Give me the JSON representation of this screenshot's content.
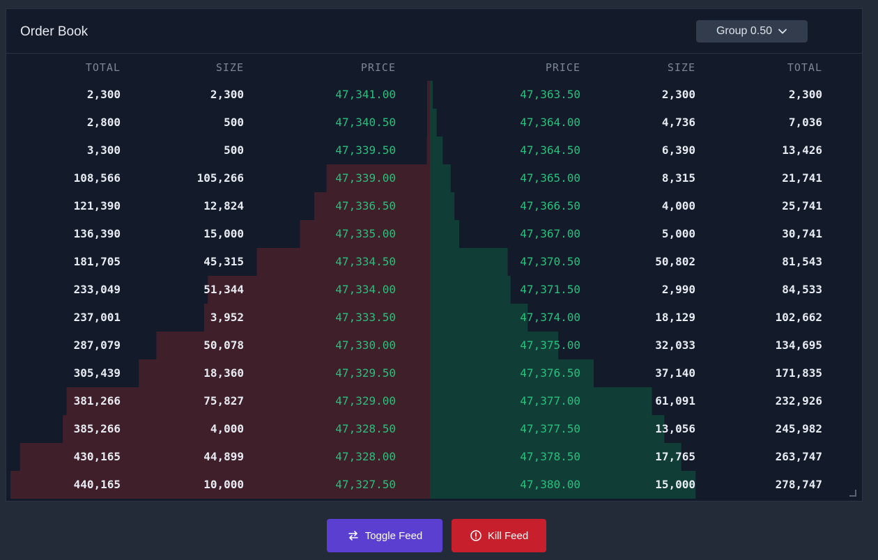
{
  "header": {
    "title": "Order Book",
    "group_label": "Group 0.50"
  },
  "bids": {
    "columns": [
      "TOTAL",
      "SIZE",
      "PRICE"
    ],
    "rows": [
      {
        "total": "2,300",
        "size": "2,300",
        "price": "47,341.00"
      },
      {
        "total": "2,800",
        "size": "500",
        "price": "47,340.50"
      },
      {
        "total": "3,300",
        "size": "500",
        "price": "47,339.50"
      },
      {
        "total": "108,566",
        "size": "105,266",
        "price": "47,339.00"
      },
      {
        "total": "121,390",
        "size": "12,824",
        "price": "47,336.50"
      },
      {
        "total": "136,390",
        "size": "15,000",
        "price": "47,335.00"
      },
      {
        "total": "181,705",
        "size": "45,315",
        "price": "47,334.50"
      },
      {
        "total": "233,049",
        "size": "51,344",
        "price": "47,334.00"
      },
      {
        "total": "237,001",
        "size": "3,952",
        "price": "47,333.50"
      },
      {
        "total": "287,079",
        "size": "50,078",
        "price": "47,330.00"
      },
      {
        "total": "305,439",
        "size": "18,360",
        "price": "47,329.50"
      },
      {
        "total": "381,266",
        "size": "75,827",
        "price": "47,329.00"
      },
      {
        "total": "385,266",
        "size": "4,000",
        "price": "47,328.50"
      },
      {
        "total": "430,165",
        "size": "44,899",
        "price": "47,328.00"
      },
      {
        "total": "440,165",
        "size": "10,000",
        "price": "47,327.50"
      }
    ]
  },
  "asks": {
    "columns": [
      "PRICE",
      "SIZE",
      "TOTAL"
    ],
    "rows": [
      {
        "price": "47,363.50",
        "size": "2,300",
        "total": "2,300"
      },
      {
        "price": "47,364.00",
        "size": "4,736",
        "total": "7,036"
      },
      {
        "price": "47,364.50",
        "size": "6,390",
        "total": "13,426"
      },
      {
        "price": "47,365.00",
        "size": "8,315",
        "total": "21,741"
      },
      {
        "price": "47,366.50",
        "size": "4,000",
        "total": "25,741"
      },
      {
        "price": "47,367.00",
        "size": "5,000",
        "total": "30,741"
      },
      {
        "price": "47,370.50",
        "size": "50,802",
        "total": "81,543"
      },
      {
        "price": "47,371.50",
        "size": "2,990",
        "total": "84,533"
      },
      {
        "price": "47,374.00",
        "size": "18,129",
        "total": "102,662"
      },
      {
        "price": "47,375.00",
        "size": "32,033",
        "total": "134,695"
      },
      {
        "price": "47,376.50",
        "size": "37,140",
        "total": "171,835"
      },
      {
        "price": "47,377.00",
        "size": "61,091",
        "total": "232,926"
      },
      {
        "price": "47,377.50",
        "size": "13,056",
        "total": "245,982"
      },
      {
        "price": "47,378.50",
        "size": "17,765",
        "total": "263,747"
      },
      {
        "price": "47,380.00",
        "size": "15,000",
        "total": "278,747"
      }
    ]
  },
  "buttons": {
    "toggle_label": "Toggle Feed",
    "kill_label": "Kill Feed"
  },
  "icons": {
    "group_select": "chevron-down-icon",
    "toggle": "swap-arrows-icon",
    "kill": "alert-circle-icon"
  },
  "colors": {
    "bid_depth": "#3f1f2a",
    "ask_depth": "#113d37",
    "price": "#27c07d",
    "toggle_button": "#5b3fd1",
    "kill_button": "#c71f2b"
  }
}
